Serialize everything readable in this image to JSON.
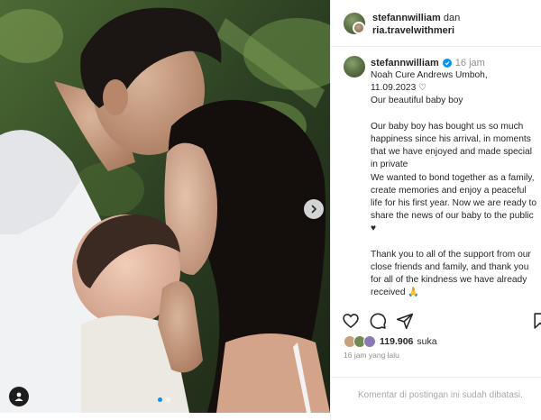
{
  "post": {
    "header": {
      "username": "stefannwilliam",
      "connector": "dan",
      "collaborator": "ria.travelwithmeri"
    },
    "caption": {
      "username": "stefannwilliam",
      "time": "16 jam",
      "text": "Noah Cure Andrews Umboh,\n11.09.2023 ♡\nOur beautiful baby boy\n\nOur baby boy has bought us so much happiness since his arrival, in moments that we have enjoyed and made special in private\nWe wanted to bond together as a family, create memories and enjoy a peaceful life for his first year. Now we are ready to share the news of our baby to the public ♥\n\nThank you to all of the support from our close friends and family, and thank you for all of the kindness we have already received 🙏"
    },
    "likes": {
      "count": "119.906",
      "suffix": "suka"
    },
    "time_ago": "16 jam yang lalu",
    "comments_disabled": "Komentar di postingan ini sudah dibatasi.",
    "carousel": {
      "current": 1,
      "total": 2
    }
  },
  "icons": {
    "like": "heart-icon",
    "comment": "comment-icon",
    "share": "share-icon",
    "save": "bookmark-icon",
    "next": "chevron-right-icon",
    "tags": "user-tag-icon",
    "verified": "verified-badge-icon"
  },
  "colors": {
    "accent": "#0095f6",
    "text": "#262626",
    "muted": "#8e8e8e"
  }
}
